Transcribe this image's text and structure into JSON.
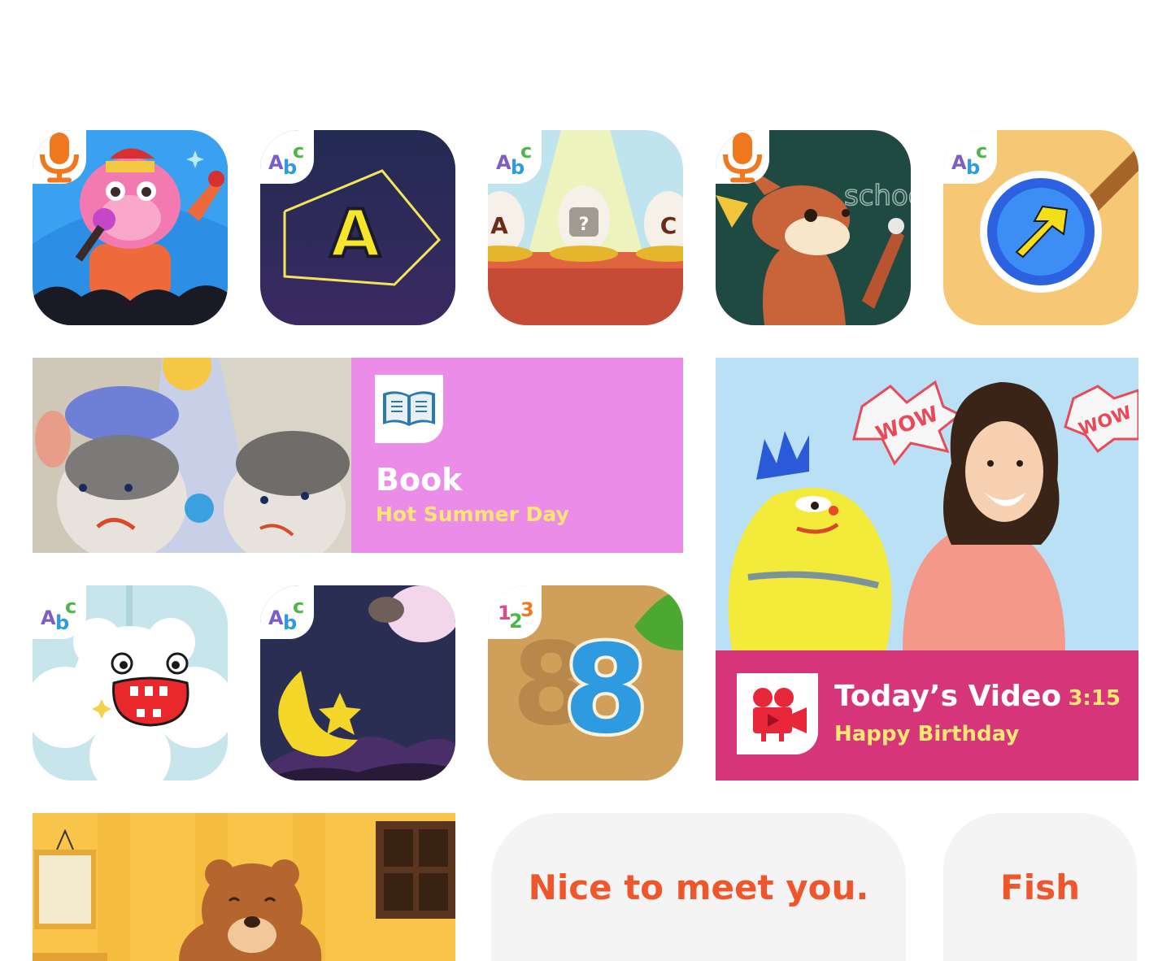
{
  "app_tiles": [
    {
      "badge": "mic-icon",
      "theme": "singing-monkey"
    },
    {
      "badge": "abc",
      "letter": "A",
      "theme": "star-constellation"
    },
    {
      "badge": "abc",
      "egg_letters": [
        "A",
        "?",
        "C"
      ],
      "theme": "egg-alphabet"
    },
    {
      "badge": "mic-icon",
      "chalkboard_text": "school",
      "theme": "fox-teacher"
    },
    {
      "badge": "abc",
      "theme": "arrow-button"
    },
    {
      "badge": "abc",
      "theme": "bubble-monster"
    },
    {
      "badge": "abc",
      "theme": "moon-star-night"
    },
    {
      "badge": "123",
      "number": "8",
      "theme": "number-puzzle"
    }
  ],
  "badge_text": {
    "abc": [
      "A",
      "b",
      "c"
    ],
    "num": [
      "1",
      "2",
      "3"
    ]
  },
  "book_card": {
    "type_label": "Book",
    "title": "Hot Summer Day",
    "icon": "open-book-icon"
  },
  "video_card": {
    "type_label": "Today’s Video",
    "title": "Happy Birthday",
    "duration": "3:15",
    "icon": "movie-camera-icon",
    "wow_text": "WOW"
  },
  "phrases": [
    {
      "text": "Nice to meet you."
    },
    {
      "text": "Fish"
    }
  ],
  "colors": {
    "accent_orange": "#f0562c",
    "book_pink": "#ea8ce8",
    "video_magenta": "#d7357a",
    "title_yellow": "#ffe773"
  }
}
